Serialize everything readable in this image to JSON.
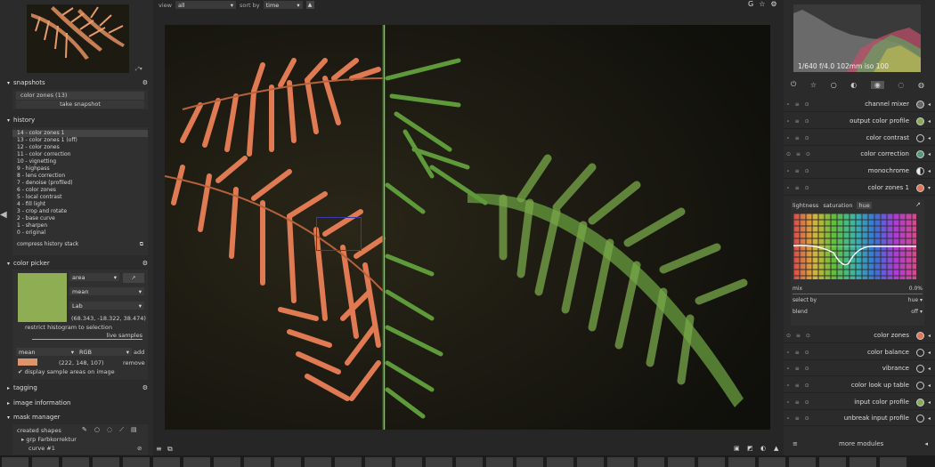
{
  "topbar": {
    "view_label": "view",
    "view_value": "all",
    "sort_label": "sort by",
    "sort_value": "time"
  },
  "left": {
    "snapshots": {
      "title": "snapshots",
      "item": "color zones (13)",
      "take": "take snapshot"
    },
    "history": {
      "title": "history",
      "items": [
        "14 - color zones 1",
        "13 - color zones 1 (off)",
        "12 - color zones",
        "11 - color correction",
        "10 - vignetting",
        "9 - highpass",
        "8 - lens correction",
        "7 - denoise (profiled)",
        "6 - color zones",
        "5 - local contrast",
        "4 - fill light",
        "3 - crop and rotate",
        "2 - base curve",
        "1 - sharpen",
        "0 - original"
      ],
      "compress": "compress history stack"
    },
    "color_picker": {
      "title": "color picker",
      "mode": "area",
      "stat": "mean",
      "space": "Lab",
      "values": "(68.343, -18.322, 38.474)",
      "restrict": "restrict histogram to selection",
      "live": "live samples",
      "sample_stat": "mean",
      "sample_space": "RGB",
      "add": "add",
      "sample_values": "(222, 148, 107)",
      "remove": "remove",
      "display": "display sample areas on image",
      "swatch_color": "#8fad52",
      "sample_color": "#de946b"
    },
    "tagging": "tagging",
    "image_information": "image information",
    "mask_manager": {
      "title": "mask manager",
      "created": "created shapes",
      "group": "grp Farbkorrektur",
      "curve": "curve #1"
    }
  },
  "right": {
    "exif": "1/640 f/4.0 102mm iso 100",
    "modules": [
      {
        "name": "channel mixer"
      },
      {
        "name": "output color profile"
      },
      {
        "name": "color contrast"
      },
      {
        "name": "color correction"
      },
      {
        "name": "monochrome"
      },
      {
        "name": "color zones 1"
      }
    ],
    "colorzones": {
      "tab_lightness": "lightness",
      "tab_saturation": "saturation",
      "tab_hue": "hue",
      "mix_label": "mix",
      "mix_value": "0.0%",
      "select_label": "select by",
      "select_value": "hue",
      "blend_label": "blend",
      "blend_value": "off"
    },
    "modules2": [
      {
        "name": "color zones"
      },
      {
        "name": "color balance"
      },
      {
        "name": "vibrance"
      },
      {
        "name": "color look up table"
      },
      {
        "name": "input color profile"
      },
      {
        "name": "unbreak input profile"
      }
    ],
    "more_modules": "more modules"
  }
}
